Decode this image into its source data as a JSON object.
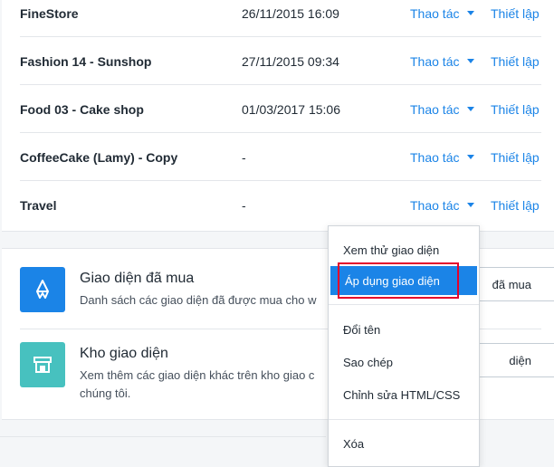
{
  "themes": [
    {
      "name": "FineStore",
      "date": "26/11/2015 16:09",
      "actions": "Thao tác",
      "setup": "Thiết lập"
    },
    {
      "name": "Fashion 14 - Sunshop",
      "date": "27/11/2015 09:34",
      "actions": "Thao tác",
      "setup": "Thiết lập"
    },
    {
      "name": "Food 03 - Cake shop",
      "date": "01/03/2017 15:06",
      "actions": "Thao tác",
      "setup": "Thiết lập"
    },
    {
      "name": "CoffeeCake (Lamy) - Copy",
      "date": "-",
      "actions": "Thao tác",
      "setup": "Thiết lập"
    },
    {
      "name": "Travel",
      "date": "-",
      "actions": "Thao tác",
      "setup": "Thiết lập"
    }
  ],
  "purchased": {
    "title": "Giao diện đã mua",
    "desc": "Danh sách các giao diện đã được mua cho w",
    "button": "đã mua",
    "icon": "theme-purchased-icon"
  },
  "store": {
    "title": "Kho giao diện",
    "desc": "Xem thêm các giao diện khác trên kho giao c",
    "desc2": "chúng tôi.",
    "button": "diện",
    "icon": "store-icon"
  },
  "dropdown": {
    "preview": "Xem thử giao diện",
    "apply": "Áp dụng giao diện",
    "rename": "Đổi tên",
    "copy": "Sao chép",
    "edit": "Chỉnh sửa HTML/CSS",
    "delete": "Xóa"
  },
  "colors": {
    "link": "#1b84e7",
    "purchased_icon_bg": "#1b84e7",
    "store_icon_bg": "#47c1bf",
    "highlight": "#e4002b"
  }
}
